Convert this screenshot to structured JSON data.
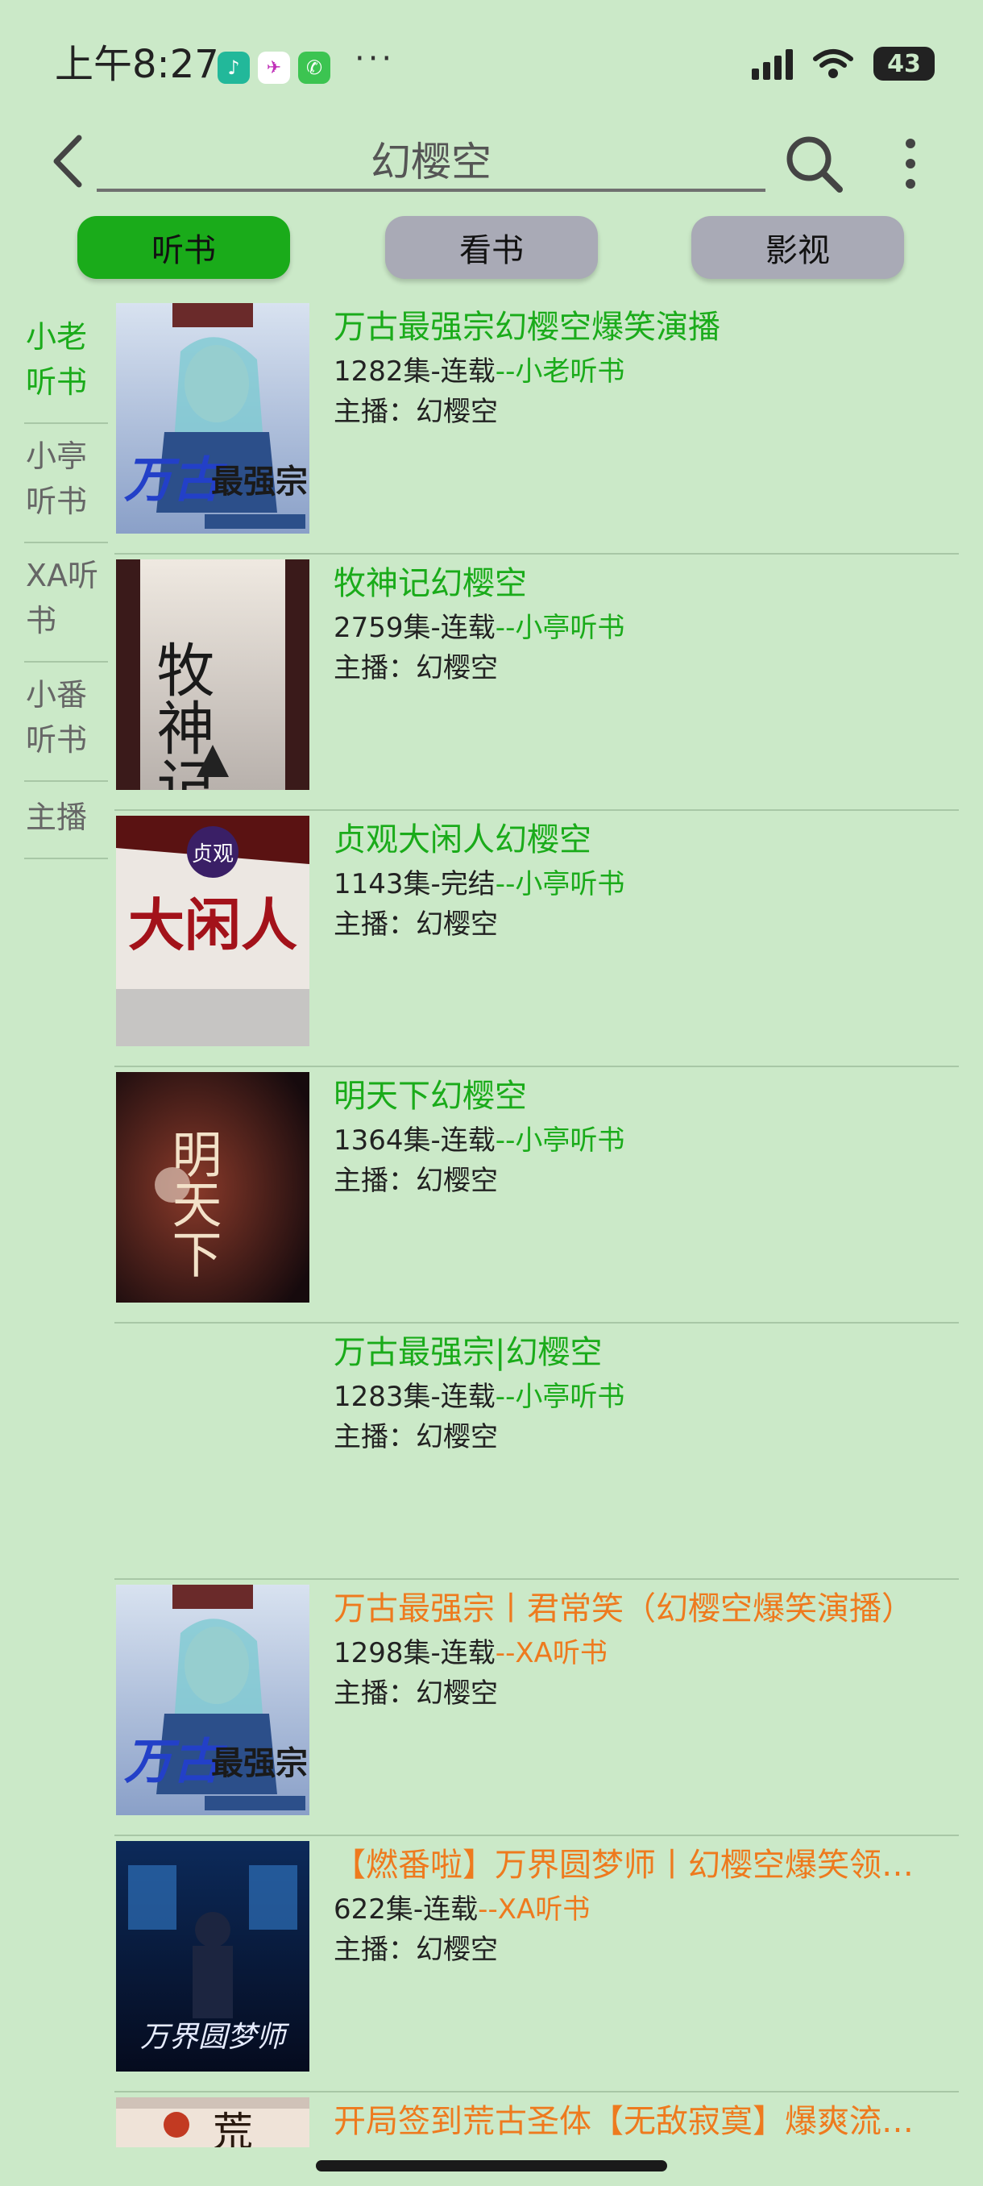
{
  "status_bar": {
    "time": "上午8:27",
    "more": "···",
    "battery": "43"
  },
  "search": {
    "query": "幻樱空"
  },
  "category_tabs": [
    {
      "label": "听书",
      "active": true
    },
    {
      "label": "看书",
      "active": false
    },
    {
      "label": "影视",
      "active": false
    }
  ],
  "sidebar": {
    "items": [
      {
        "label": "小老\n听书",
        "active": true
      },
      {
        "label": "小亭\n听书",
        "active": false
      },
      {
        "label": "XA听\n书",
        "active": false
      },
      {
        "label": "小番\n听书",
        "active": false
      },
      {
        "label": "主播",
        "active": false
      }
    ]
  },
  "results": [
    {
      "title": "万古最强宗幻樱空爆笑演播",
      "episodes": "1282集-连载",
      "source": "--小老听书",
      "host_label": "主播：",
      "host": "幻樱空",
      "color": "green"
    },
    {
      "title": "牧神记幻樱空",
      "episodes": "2759集-连载",
      "source": "--小亭听书",
      "host_label": "主播：",
      "host": "幻樱空",
      "color": "green"
    },
    {
      "title": "贞观大闲人幻樱空",
      "episodes": "1143集-完结",
      "source": "--小亭听书",
      "host_label": "主播：",
      "host": "幻樱空",
      "color": "green"
    },
    {
      "title": "明天下幻樱空",
      "episodes": "1364集-连载",
      "source": "--小亭听书",
      "host_label": "主播：",
      "host": "幻樱空",
      "color": "green"
    },
    {
      "title": "万古最强宗|幻樱空",
      "episodes": "1283集-连载",
      "source": "--小亭听书",
      "host_label": "主播：",
      "host": "幻樱空",
      "color": "green"
    },
    {
      "title": "万古最强宗丨君常笑（幻樱空爆笑演播）",
      "episodes": "1298集-连载",
      "source": "--XA听书",
      "host_label": "主播：",
      "host": "幻樱空",
      "color": "orange"
    },
    {
      "title": "【燃番啦】万界圆梦师丨幻樱空爆笑领…",
      "episodes": "622集-连载",
      "source": "--XA听书",
      "host_label": "主播：",
      "host": "幻樱空",
      "color": "orange"
    },
    {
      "title": "开局签到荒古圣体【无敌寂寞】爆爽流…",
      "color": "orange"
    }
  ],
  "covers": {
    "c1": {
      "big": "万古",
      "small": "最强宗"
    },
    "c2": {
      "text": "牧神记"
    },
    "c3": {
      "badge": "贞观",
      "text": "大闲人"
    },
    "c4": {
      "text": "明天下"
    },
    "c6": {
      "big": "万古",
      "small": "最强宗"
    },
    "c7": {
      "text": "万界圆梦师"
    },
    "c8": {
      "text": "荒"
    }
  },
  "colors": {
    "background": "#cbe9c8",
    "accent_green": "#1aab1a",
    "accent_orange": "#ee7a1e",
    "tab_inactive": "#a9aab6"
  }
}
